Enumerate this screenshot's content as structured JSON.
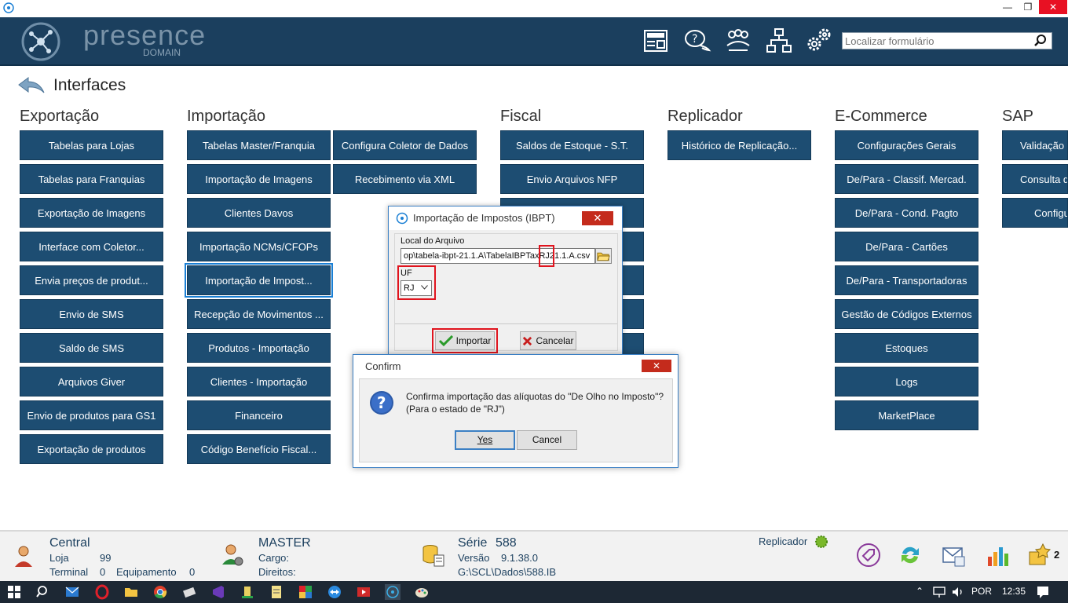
{
  "header": {
    "brand_main": "presence",
    "brand_sub": "DOMAIN",
    "search_placeholder": "Localizar formulário",
    "icons": [
      "news-icon",
      "help-chat-icon",
      "users-icon",
      "network-icon",
      "settings-gears-icon"
    ]
  },
  "page": {
    "title": "Interfaces"
  },
  "columns": [
    {
      "title": "Exportação",
      "items": [
        "Tabelas para Lojas",
        "Tabelas para Franquias",
        "Exportação de Imagens",
        "Interface com Coletor...",
        "Envia preços de produt...",
        "Envio de SMS",
        "Saldo de SMS",
        "Arquivos Giver",
        "Envio de produtos para GS1",
        "Exportação de produtos"
      ]
    },
    {
      "title": "Importação",
      "items": [
        "Tabelas Master/Franquia",
        "Importação de Imagens",
        "Clientes Davos",
        "Importação NCMs/CFOPs",
        "Importação de Impost...",
        "Recepção de Movimentos ...",
        "Produtos - Importação",
        "Clientes - Importação",
        "Financeiro",
        "Código Benefício Fiscal..."
      ],
      "items2": [
        "Configura Coletor de Dados",
        "Recebimento via XML"
      ]
    },
    {
      "title": "Fiscal",
      "items": [
        "Saldos de Estoque - S.T.",
        "Envio Arquivos NFP"
      ]
    },
    {
      "title": "Replicador",
      "items": [
        "Histórico de Replicação..."
      ]
    },
    {
      "title": "E-Commerce",
      "items": [
        "Configurações Gerais",
        "De/Para - Classif. Mercad.",
        "De/Para - Cond. Pagto",
        "De/Para - Cartões",
        "De/Para - Transportadoras",
        "Gestão de Códigos Externos",
        "Estoques",
        "Logs",
        "MarketPlace"
      ]
    },
    {
      "title": "SAP",
      "items": [
        "Validação",
        "Consulta d",
        "Configu"
      ]
    }
  ],
  "ibpt_dialog": {
    "title": "Importação de Impostos (IBPT)",
    "file_label": "Local do Arquivo",
    "file_value": "op\\tabela-ibpt-21.1.A\\TabelaIBPTaxRJ21.1.A.csv",
    "uf_label": "UF",
    "uf_value": "RJ",
    "import_label": "Importar",
    "cancel_label": "Cancelar"
  },
  "confirm_dialog": {
    "title": "Confirm",
    "message_line1": "Confirma importação das alíquotas do \"De Olho no Imposto\"?",
    "message_line2": "(Para o estado de \"RJ\")",
    "yes_label": "Yes",
    "cancel_label": "Cancel"
  },
  "status": {
    "company": "Central",
    "loja_label": "Loja",
    "loja_value": "99",
    "terminal_label": "Terminal",
    "terminal_value": "0",
    "equip_label": "Equipamento",
    "equip_value": "0",
    "user": "MASTER",
    "cargo_label": "Cargo:",
    "direitos_label": "Direitos:",
    "serie_label": "Série",
    "serie_value": "588",
    "versao_label": "Versão",
    "versao_value": "9.1.38.0",
    "path": "G:\\SCL\\Dados\\588.IB",
    "replicador_label": "Replicador",
    "notif_count": "2"
  },
  "taskbar": {
    "lang": "POR",
    "time": "12:35"
  },
  "colors": {
    "header": "#1b3f5e",
    "tile": "#1d4d72",
    "highlight": "#e0141e"
  }
}
